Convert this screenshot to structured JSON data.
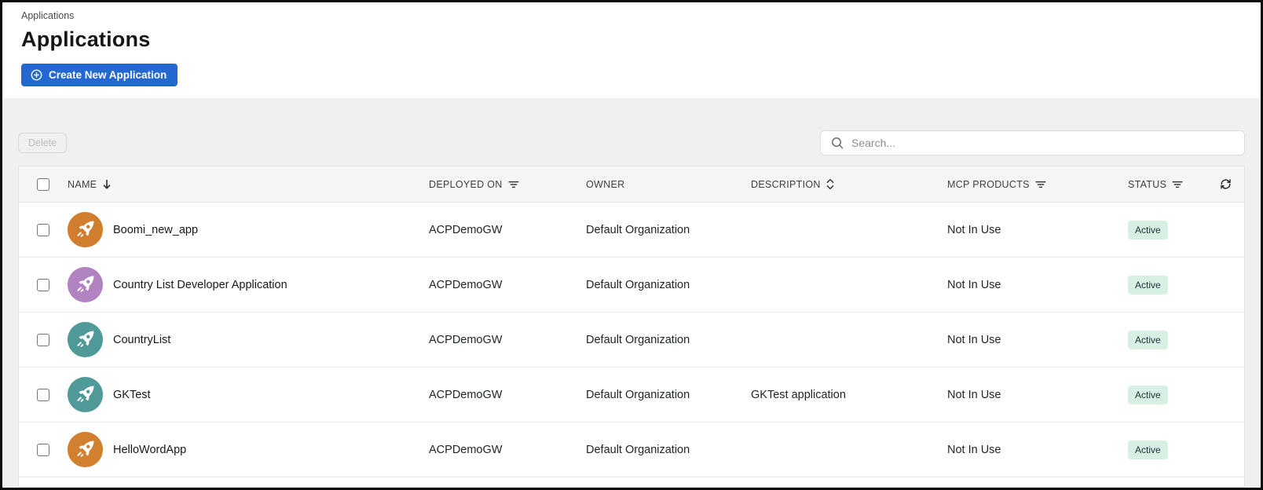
{
  "breadcrumb": "Applications",
  "page_title": "Applications",
  "create_button_label": "Create New Application",
  "toolbar": {
    "delete_label": "Delete",
    "search_placeholder": "Search..."
  },
  "table": {
    "columns": {
      "name": "NAME",
      "deployed_on": "DEPLOYED ON",
      "owner": "OWNER",
      "description": "DESCRIPTION",
      "mcp_products": "MCP PRODUCTS",
      "status": "STATUS"
    },
    "column_icons": {
      "name": "arrow-down-sort-icon",
      "deployed_on": "filter-icon",
      "description": "sort-updown-icon",
      "mcp_products": "filter-icon",
      "status": "filter-icon",
      "refresh": "refresh-icon"
    },
    "rows": [
      {
        "name": "Boomi_new_app",
        "deployed_on": "ACPDemoGW",
        "owner": "Default Organization",
        "description": "",
        "mcp_products": "Not In Use",
        "status": "Active",
        "icon_color": "#d07d2e"
      },
      {
        "name": "Country List Developer Application",
        "deployed_on": "ACPDemoGW",
        "owner": "Default Organization",
        "description": "",
        "mcp_products": "Not In Use",
        "status": "Active",
        "icon_color": "#b183c1"
      },
      {
        "name": "CountryList",
        "deployed_on": "ACPDemoGW",
        "owner": "Default Organization",
        "description": "",
        "mcp_products": "Not In Use",
        "status": "Active",
        "icon_color": "#4f9a99"
      },
      {
        "name": "GKTest",
        "deployed_on": "ACPDemoGW",
        "owner": "Default Organization",
        "description": "GKTest application",
        "mcp_products": "Not In Use",
        "status": "Active",
        "icon_color": "#4f9a99"
      },
      {
        "name": "HelloWordApp",
        "deployed_on": "ACPDemoGW",
        "owner": "Default Organization",
        "description": "",
        "mcp_products": "Not In Use",
        "status": "Active",
        "icon_color": "#d0802f"
      }
    ]
  },
  "colors": {
    "accent_blue": "#2368d1",
    "content_background": "#f0f0f1",
    "header_row_background": "#f6f6f7",
    "status_badge_background": "#d8efe4",
    "status_badge_text": "#23313d",
    "avatar_orange": "#d07d2e",
    "avatar_purple": "#b183c1",
    "avatar_teal": "#4f9a99"
  }
}
